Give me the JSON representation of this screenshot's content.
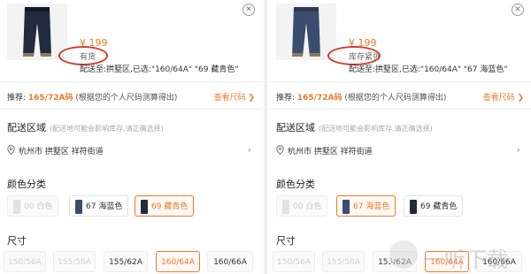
{
  "panels": [
    {
      "price": "¥ 199",
      "stock_status": "有货",
      "delivery_selection": "配送至:拱墅区,已选:\"160/64A\" \"69 藏青色\"",
      "recommend": {
        "label": "推荐: ",
        "size": "165/72A码",
        "note": " (根据您的个人尺码测算得出)",
        "link": "查看尺码 ❯"
      },
      "delivery_title": "配送区域",
      "delivery_note": "(配送地可能会影响库存,请正确选择)",
      "address": "杭州市 拱墅区 祥符街道",
      "color_title": "颜色分类",
      "colors": [
        {
          "label": "00 白色",
          "swatch": "#dedede",
          "state": "disabled"
        },
        {
          "label": "67 海蓝色",
          "swatch": "#3a4d6e",
          "state": "normal"
        },
        {
          "label": "69 藏青色",
          "swatch": "#222b3d",
          "state": "selected"
        }
      ],
      "size_title": "尺寸",
      "sizes": [
        {
          "label": "150/56A",
          "state": "disabled"
        },
        {
          "label": "155/58A",
          "state": "disabled"
        },
        {
          "label": "155/62A",
          "state": "normal"
        },
        {
          "label": "160/64A",
          "state": "selected"
        },
        {
          "label": "160/66A",
          "state": "normal"
        }
      ]
    },
    {
      "price": "¥ 199",
      "stock_status": "库存紧张",
      "delivery_selection": "配送至:拱墅区,已选:\"160/64A\" \"67 海蓝色\"",
      "recommend": {
        "label": "推荐: ",
        "size": "165/72A码",
        "note": " (根据您的个人尺码测算得出)",
        "link": "查看尺码 ❯"
      },
      "delivery_title": "配送区域",
      "delivery_note": "(配送地可能会影响库存,请正确选择)",
      "address": "杭州市 拱墅区 祥符街道",
      "color_title": "颜色分类",
      "colors": [
        {
          "label": "00 白色",
          "swatch": "#dedede",
          "state": "disabled"
        },
        {
          "label": "67 海蓝色",
          "swatch": "#3a4d6e",
          "state": "selected"
        },
        {
          "label": "69 藏青色",
          "swatch": "#222b3d",
          "state": "normal"
        }
      ],
      "size_title": "尺寸",
      "sizes": [
        {
          "label": "150/56A",
          "state": "disabled"
        },
        {
          "label": "155/58A",
          "state": "disabled"
        },
        {
          "label": "155/62A",
          "state": "normal"
        },
        {
          "label": "160/64A",
          "state": "selected"
        },
        {
          "label": "160/66A",
          "state": "normal"
        }
      ]
    }
  ],
  "watermark": {
    "text": "一听下载",
    "symbol": "听"
  },
  "colors": {
    "accent": "#ef7a2b",
    "annotation": "#d13a2f"
  },
  "icons": {
    "close": "close-icon",
    "location": "location-pin-icon",
    "chevron": "chevron-right-icon"
  }
}
